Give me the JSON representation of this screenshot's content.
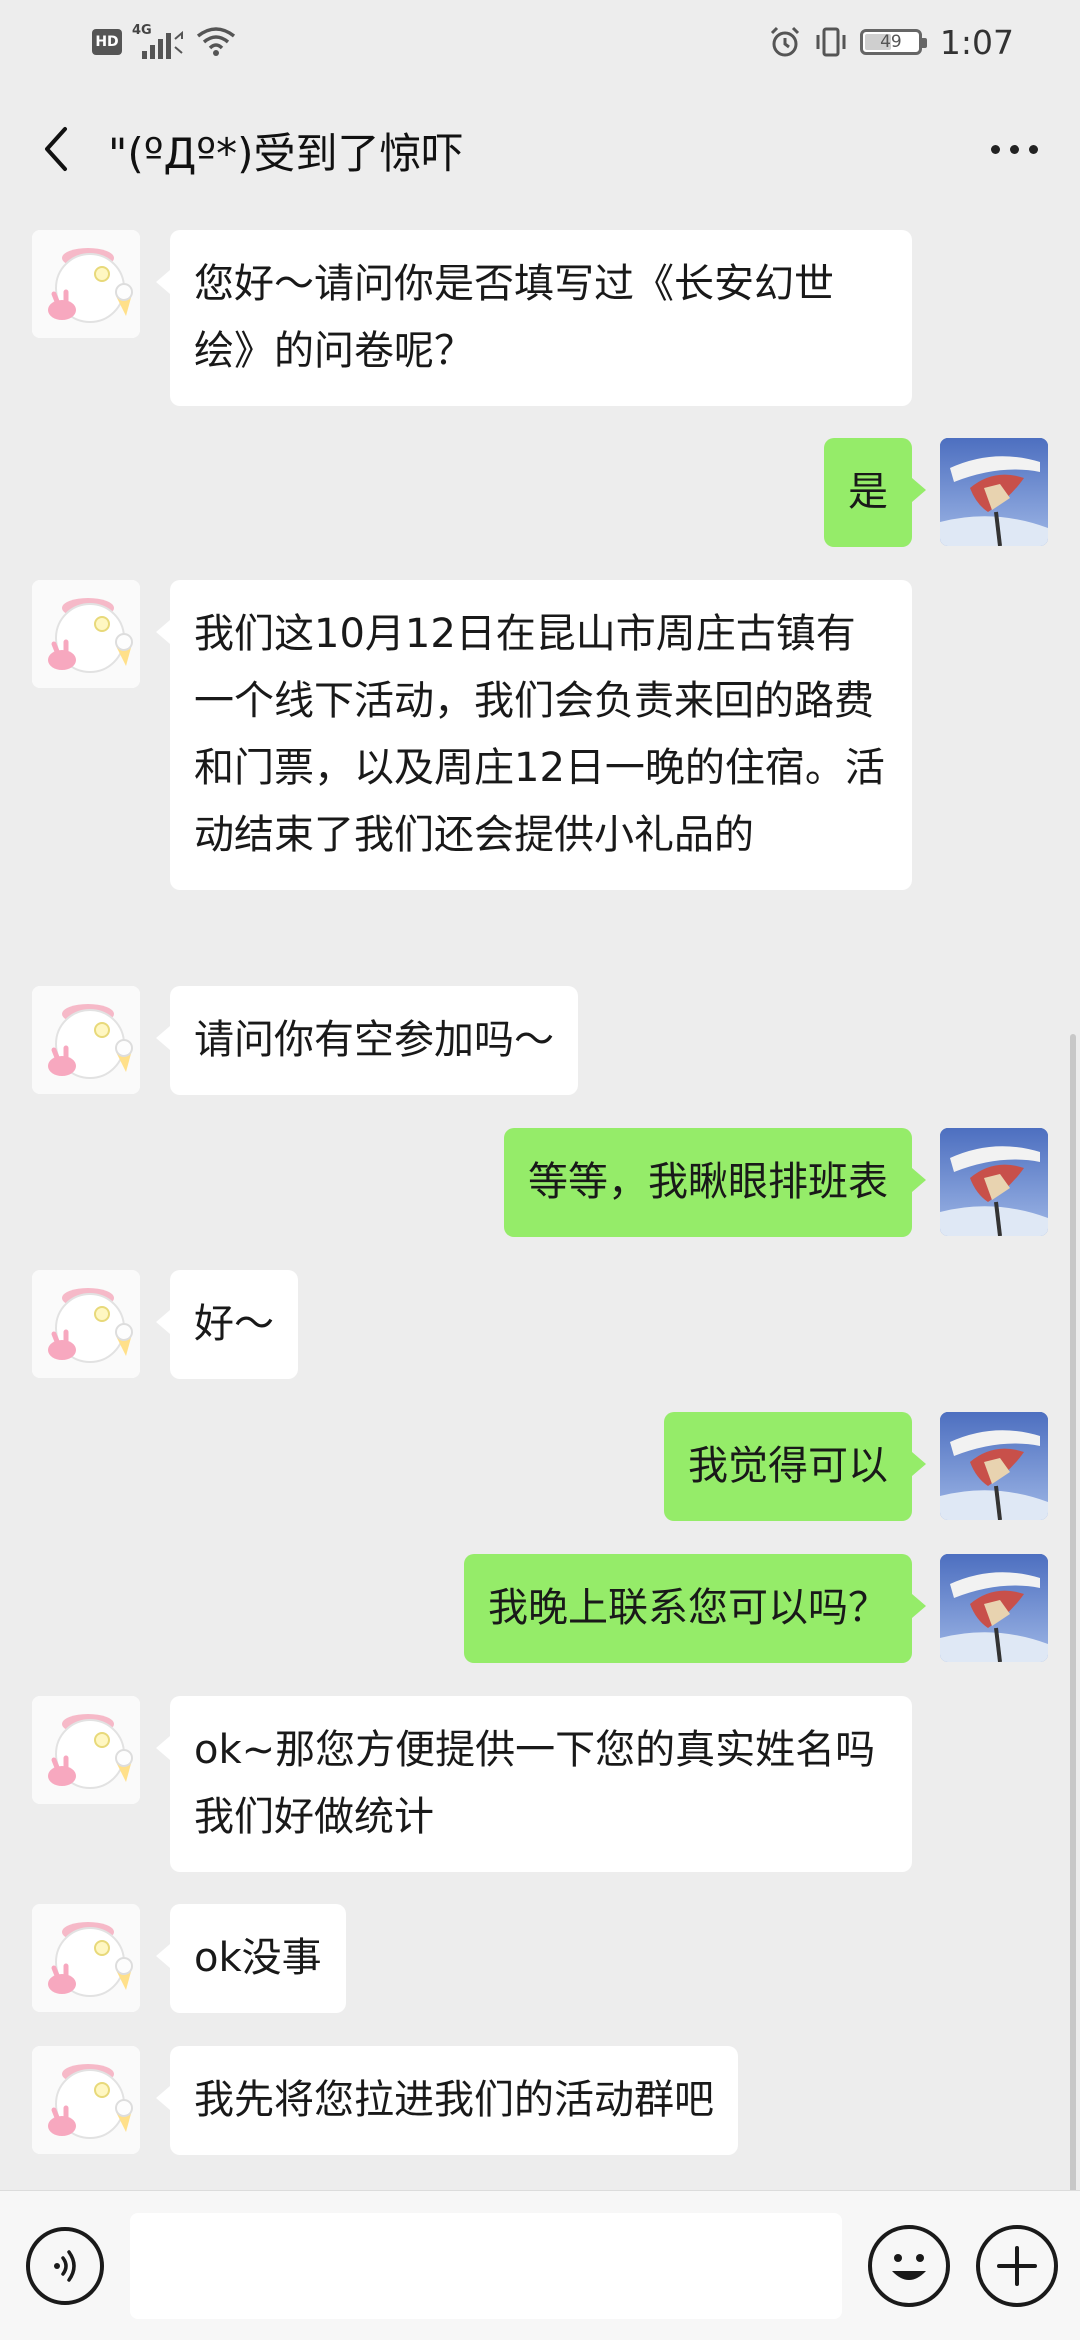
{
  "status_bar": {
    "hd_label": "HD",
    "network_label": "4G",
    "battery_level": "49",
    "time": "1:07"
  },
  "header": {
    "title": "\"(ºДº*)受到了惊吓"
  },
  "messages": [
    {
      "side": "left",
      "text": "您好～请问你是否填写过《长安幻世绘》的问卷呢？"
    },
    {
      "side": "right",
      "text": "是"
    },
    {
      "side": "left",
      "text": "我们这10月12日在昆山市周庄古镇有一个线下活动，我们会负责来回的路费和门票，以及周庄12日一晚的住宿。活动结束了我们还会提供小礼品的"
    },
    {
      "side": "left",
      "text": "请问你有空参加吗～"
    },
    {
      "side": "right",
      "text": "等等，我瞅眼排班表"
    },
    {
      "side": "left",
      "text": "好～"
    },
    {
      "side": "right",
      "text": "我觉得可以"
    },
    {
      "side": "right",
      "text": "我晚上联系您可以吗？"
    },
    {
      "side": "left",
      "text": "ok~那您方便提供一下您的真实姓名吗 我们好做统计"
    },
    {
      "side": "left",
      "text": "ok没事"
    },
    {
      "side": "left",
      "text": "我先将您拉进我们的活动群吧"
    }
  ],
  "input": {
    "value": "",
    "placeholder": ""
  },
  "colors": {
    "background": "#ededed",
    "bubble_self": "#95ec69",
    "bubble_other": "#ffffff"
  },
  "icons": {
    "back": "chevron-left-icon",
    "more": "more-dots-icon",
    "voice": "voice-icon",
    "emoji": "emoji-icon",
    "plus": "plus-icon"
  }
}
